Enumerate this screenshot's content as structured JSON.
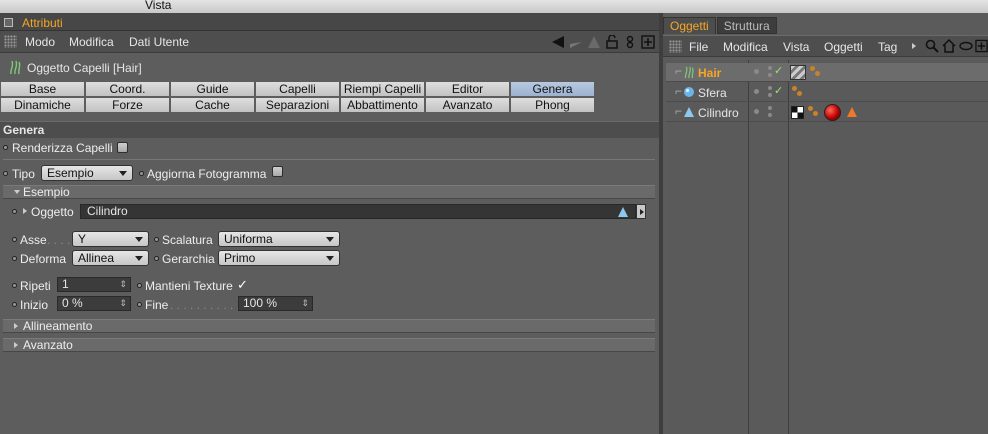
{
  "system_menu": {
    "vista": "Vista"
  },
  "attr_panel": {
    "title": "Attributi",
    "menu": [
      "Modo",
      "Modifica",
      "Dati Utente"
    ],
    "object_title": "Oggetto Capelli [Hair]",
    "tabs_row1": [
      "Base",
      "Coord.",
      "Guide",
      "Capelli",
      "Riempi Capelli",
      "Editor",
      "Genera"
    ],
    "tabs_row2": [
      "Dinamiche",
      "Forze",
      "Cache",
      "Separazioni",
      "Abbattimento",
      "Avanzato",
      "Phong"
    ],
    "active_tab": "Genera",
    "section_title": "Genera",
    "renderizza_label": "Renderizza Capelli",
    "tipo_label": "Tipo",
    "tipo_value": "Esempio",
    "aggiorna_label": "Aggiorna Fotogramma",
    "esempio_header": "Esempio",
    "oggetto_label": "Oggetto",
    "oggetto_value": "Cilindro",
    "asse_label": "Asse",
    "asse_value": "Y",
    "scalatura_label": "Scalatura",
    "scalatura_value": "Uniforma",
    "deforma_label": "Deforma",
    "deforma_value": "Allinea",
    "gerarchia_label": "Gerarchia",
    "gerarchia_value": "Primo",
    "ripeti_label": "Ripeti",
    "ripeti_value": "1",
    "mantieni_label": "Mantieni Texture",
    "mantieni_mark": "✓",
    "inizio_label": "Inizio",
    "inizio_value": "0 %",
    "fine_label": "Fine",
    "fine_value": "100 %",
    "allineamento_header": "Allineamento",
    "avanzato_header": "Avanzato"
  },
  "obj_panel": {
    "tabs": [
      "Oggetti",
      "Struttura"
    ],
    "menu": [
      "File",
      "Modifica",
      "Vista",
      "Oggetti",
      "Tag"
    ],
    "objects": [
      {
        "name": "Hair",
        "color": "#f5a623",
        "check": "✓"
      },
      {
        "name": "Sfera",
        "color": "#e6e6e6",
        "check": "✓"
      },
      {
        "name": "Cilindro",
        "color": "#e6e6e6",
        "check": ""
      }
    ]
  },
  "colors": {
    "accent": "#f5a623",
    "tab_active": "#9cb2cf",
    "check": "#9fe07a"
  }
}
